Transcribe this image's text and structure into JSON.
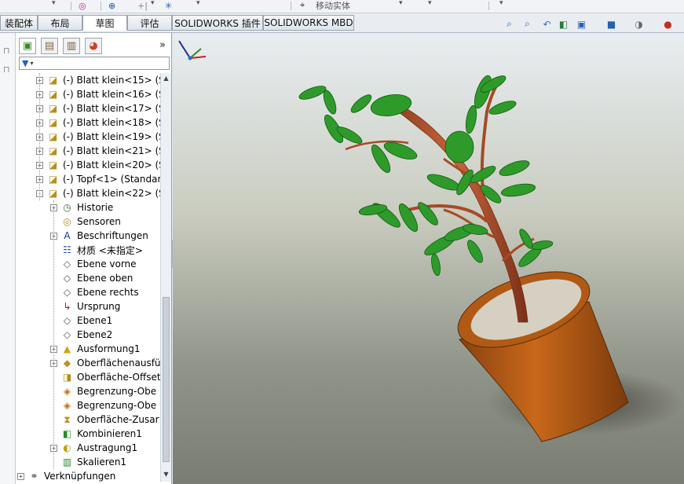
{
  "toolbar": {
    "move_body_label": "移动实体"
  },
  "tabs": [
    {
      "label": "装配体"
    },
    {
      "label": "布局"
    },
    {
      "label": "草图"
    },
    {
      "label": "评估"
    },
    {
      "label": "SOLIDWORKS 插件"
    },
    {
      "label": "SOLIDWORKS MBD"
    }
  ],
  "heads_up_icons": [
    "zoom-to-fit-icon",
    "zoom-area-icon",
    "previous-view-icon",
    "section-view-icon",
    "view-orientation-icon",
    "display-style-icon",
    "hide-show-icon",
    "appearance-icon"
  ],
  "feature_manager": {
    "tabs": [
      "feature-tree-icon",
      "property-manager-icon",
      "configuration-icon",
      "display-manager-icon"
    ],
    "more_label": "»",
    "filter_icon": "filter-icon",
    "tree": [
      {
        "label": "(-) Blatt klein<15> (S",
        "icon": "part-icon",
        "expand": "+"
      },
      {
        "label": "(-) Blatt klein<16> (S",
        "icon": "part-icon",
        "expand": "+"
      },
      {
        "label": "(-) Blatt klein<17> (S",
        "icon": "part-icon",
        "expand": "+"
      },
      {
        "label": "(-) Blatt klein<18> (S",
        "icon": "part-icon",
        "expand": "+"
      },
      {
        "label": "(-) Blatt klein<19> (S",
        "icon": "part-icon",
        "expand": "+"
      },
      {
        "label": "(-) Blatt klein<21> (S",
        "icon": "part-icon",
        "expand": "+"
      },
      {
        "label": "(-) Blatt klein<20> (S",
        "icon": "part-icon",
        "expand": "+"
      },
      {
        "label": "(-) Topf<1> (Standar",
        "icon": "part-icon",
        "expand": "+"
      },
      {
        "label": "(-) Blatt klein<22> (S",
        "icon": "part-icon",
        "expand": "-"
      },
      {
        "label": "Historie",
        "icon": "history-icon",
        "expand": "+",
        "child": true
      },
      {
        "label": "Sensoren",
        "icon": "sensor-icon",
        "expand": "",
        "child": true
      },
      {
        "label": "Beschriftungen",
        "icon": "annotation-icon",
        "expand": "+",
        "child": true
      },
      {
        "label": "材质 <未指定>",
        "icon": "material-icon",
        "expand": "",
        "child": true
      },
      {
        "label": "Ebene vorne",
        "icon": "plane-icon",
        "expand": "",
        "child": true
      },
      {
        "label": "Ebene oben",
        "icon": "plane-icon",
        "expand": "",
        "child": true
      },
      {
        "label": "Ebene rechts",
        "icon": "plane-icon",
        "expand": "",
        "child": true
      },
      {
        "label": "Ursprung",
        "icon": "origin-icon",
        "expand": "",
        "child": true
      },
      {
        "label": "Ebene1",
        "icon": "plane-icon",
        "expand": "",
        "child": true
      },
      {
        "label": "Ebene2",
        "icon": "plane-icon",
        "expand": "",
        "child": true
      },
      {
        "label": "Ausformung1",
        "icon": "loft-icon",
        "expand": "+",
        "child": true
      },
      {
        "label": "Oberflächenausfü",
        "icon": "surface-fill-icon",
        "expand": "+",
        "child": true
      },
      {
        "label": "Oberfläche-Offset",
        "icon": "surface-offset-icon",
        "expand": "",
        "child": true
      },
      {
        "label": "Begrenzung-Obe",
        "icon": "boundary-surface-icon",
        "expand": "",
        "child": true
      },
      {
        "label": "Begrenzung-Obe",
        "icon": "boundary-surface-icon",
        "expand": "",
        "child": true
      },
      {
        "label": "Oberfläche-Zusar",
        "icon": "surface-knit-icon",
        "expand": "",
        "child": true
      },
      {
        "label": "Kombinieren1",
        "icon": "combine-icon",
        "expand": "",
        "child": true
      },
      {
        "label": "Austragung1",
        "icon": "sweep-icon",
        "expand": "+",
        "child": true
      },
      {
        "label": "Skalieren1",
        "icon": "scale-icon",
        "expand": "",
        "child": true
      },
      {
        "label": "Verknüpfungen",
        "icon": "mates-icon",
        "expand": "+"
      }
    ]
  },
  "colors": {
    "leaf": "#2e8b2a",
    "stem": "#b0502a",
    "pot": "#b85e16",
    "pot_inner": "#d8d2c4"
  }
}
